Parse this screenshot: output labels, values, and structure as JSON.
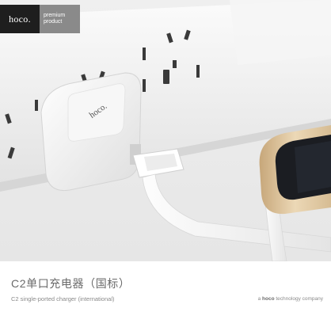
{
  "brand": {
    "logo_text": "hoco.",
    "tag_line1": "premium",
    "tag_line2": "product"
  },
  "product": {
    "charger_logo": "hoco.",
    "title_cn": "C2单口充电器（国标）",
    "title_en": "C2 single-ported charger (international)",
    "company_prefix": "a",
    "company_brand": "hoco",
    "company_suffix": "technology company"
  },
  "colors": {
    "wall": "#e9e9e9",
    "socket": "#f2f2f2",
    "charger": "#fafafa",
    "phone_gold": "#d9bf99",
    "phone_screen": "#1b1d22"
  }
}
